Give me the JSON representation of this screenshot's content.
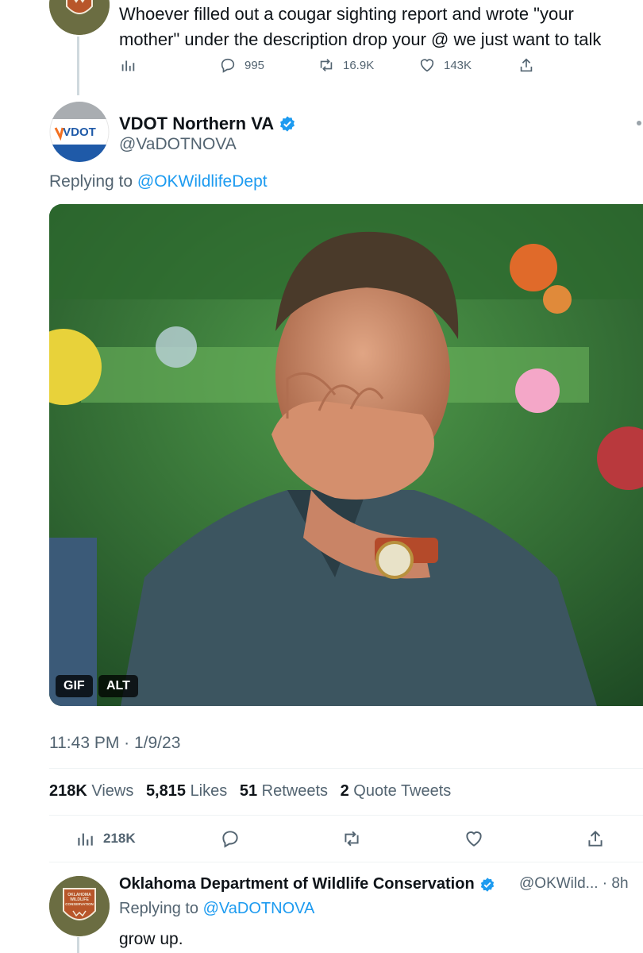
{
  "top_tweet": {
    "text": "Whoever filled out a cougar sighting report and wrote \"your mother\" under the description drop your @ we just want to talk",
    "replies": "995",
    "retweets": "16.9K",
    "likes": "143K"
  },
  "main_tweet": {
    "display_name": "VDOT Northern VA",
    "handle": "@VaDOTNOVA",
    "avatar_text": "VDOT",
    "replying_prefix": "Replying to",
    "replying_to": "@OKWildlifeDept",
    "media_badges": [
      "GIF",
      "ALT"
    ],
    "timestamp": "11:43 PM · 1/9/23",
    "stats": {
      "views_value": "218K",
      "views_label": "Views",
      "likes_value": "5,815",
      "likes_label": "Likes",
      "retweets_value": "51",
      "retweets_label": "Retweets",
      "quotes_value": "2",
      "quotes_label": "Quote Tweets"
    },
    "actions": {
      "views_count": "218K"
    }
  },
  "reply_tweet": {
    "display_name": "Oklahoma Department of Wildlife Conservation",
    "handle_time": "@OKWild... · 8h",
    "replying_prefix": "Replying to",
    "replying_to": "@VaDOTNOVA",
    "text": "grow up.",
    "avatar_text": [
      "OKLAHOMA",
      "WILDLIFE",
      "CONSERVATION"
    ]
  },
  "colors": {
    "accent": "#1d9bf0",
    "secondary_text": "#536471",
    "vdot_orange": "#f37021",
    "vdot_blue": "#1f5aa8",
    "okdwc_green": "#6b6d42"
  },
  "icons": [
    "views-icon",
    "reply-icon",
    "retweet-icon",
    "like-icon",
    "share-icon",
    "verified-badge-icon",
    "more-options-icon"
  ]
}
